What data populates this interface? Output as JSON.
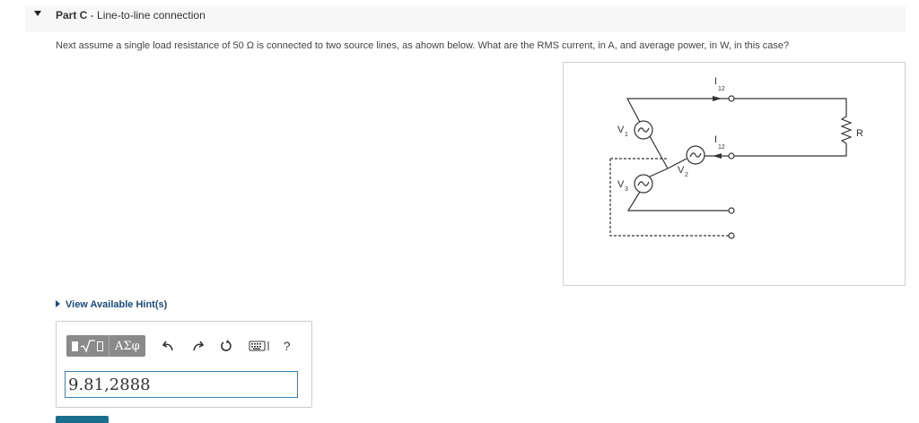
{
  "part": {
    "label": "Part C",
    "separator": " - ",
    "title": "Line-to-line connection"
  },
  "question": {
    "text": "Next assume a single load resistance of 50 Ω is connected to two source lines, as ahown below. What are the RMS current, in A, and average power, in W, in this case?"
  },
  "circuit": {
    "v1": "V",
    "v1_sub": "1",
    "v2": "V",
    "v2_sub": "2",
    "v3": "V",
    "v3_sub": "3",
    "i_top": "I",
    "i_top_sub": "12",
    "i_mid": "I",
    "i_mid_sub": "12",
    "r_label": "R"
  },
  "hint": {
    "label": "View Available Hint(s)"
  },
  "toolbar": {
    "greek_label": "ΑΣφ",
    "help_label": "?"
  },
  "answer": {
    "value": "9.81,2888"
  },
  "colors": {
    "accent": "#1b4a7a",
    "input_border": "#3c7fb0",
    "submit": "#1a6e8e"
  }
}
